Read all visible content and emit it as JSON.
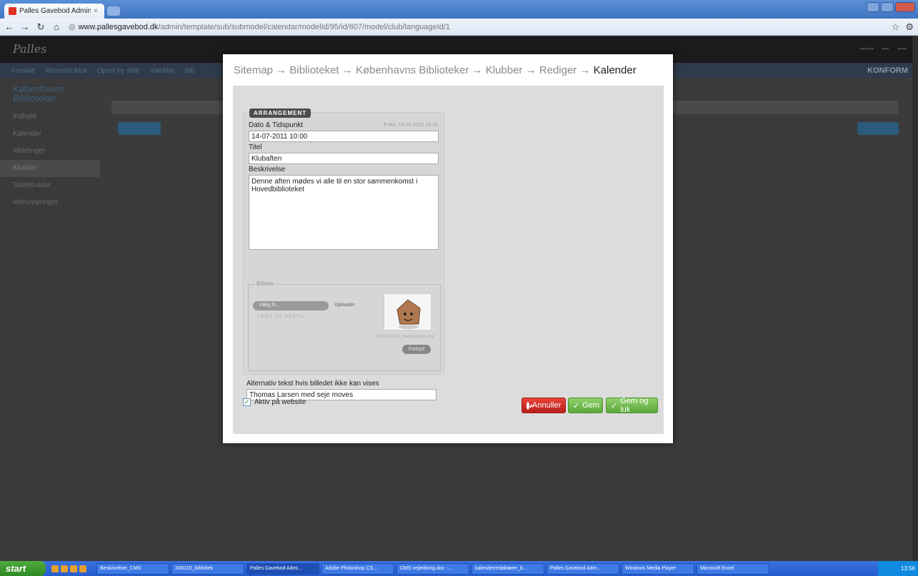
{
  "browser": {
    "tab_title": "Palles Gavebod Admin - Københ",
    "url_host": "www.pallesgavebod.dk",
    "url_path": "/admin/template/sub/submodel/calendar/modelId/95/id/607/model/club/languageId/1"
  },
  "app_bg": {
    "logo": "Palles",
    "nav_items": [
      "Forside",
      "Menustruktur",
      "Opret ny side",
      "Værktøj",
      "Bib"
    ],
    "brand": "KONFORM",
    "sidebar_title": "Københavns Biblioteker",
    "sidebar_items": [
      "Indhold",
      "Kalender",
      "Afdelinger",
      "Klubber",
      "Sidestruktur",
      "Menustyringer"
    ],
    "sidebar_selected": 3
  },
  "modal": {
    "breadcrumb": [
      "Sitemap",
      "Biblioteket",
      "Københavns Biblioteker",
      "Klubber",
      "Rediger"
    ],
    "separator": " → ",
    "current": "Kalender",
    "legend": "ARRANGEMENT",
    "date_label": "Dato & Tidspunkt",
    "date_hint": "F.eks. 14-01-2010 10:20",
    "date_value": "14-07-2011 10:00",
    "title_label": "Titel",
    "title_value": "Klubaften",
    "desc_label": "Beskrivelse",
    "desc_value": "Denne aften mødes vi alle til en stor sammenkomst i Hovedbiblioteket",
    "image_legend": "Billede",
    "choose_label": "Vælg fil...",
    "uploaded_label": "Uploadet",
    "drop_label": "TRÆK FIL HERTIL",
    "filename": "1310471020_thomaslarsen.jpg",
    "delete_label": "Fortryd",
    "alt_label": "Alternativ tekst hvis billedet ikke kan vises",
    "alt_value": "Thomas Larsen med seje moves",
    "active_label": "Aktiv på website",
    "active_checked": true,
    "cancel_label": "Annuller",
    "save_label": "Gem",
    "saveclose_label": "Gem og luk"
  },
  "taskbar": {
    "start_label": "start",
    "tasks": [
      "Beskrivelser_CMS",
      "X00110_bibliotek",
      "Palles Gavebod Admi...",
      "Adobe Photoshop CS...",
      "CMS vejledning.doc -...",
      "kalenderredaktører_b...",
      "Palles Gavebod Adm...",
      "Windows Media Player",
      "Microsoft Excel"
    ],
    "clock": "13:56"
  },
  "colors": {
    "cancel": "#c9261e",
    "save": "#6cbb47",
    "legend_bg": "#4d4d4d"
  }
}
